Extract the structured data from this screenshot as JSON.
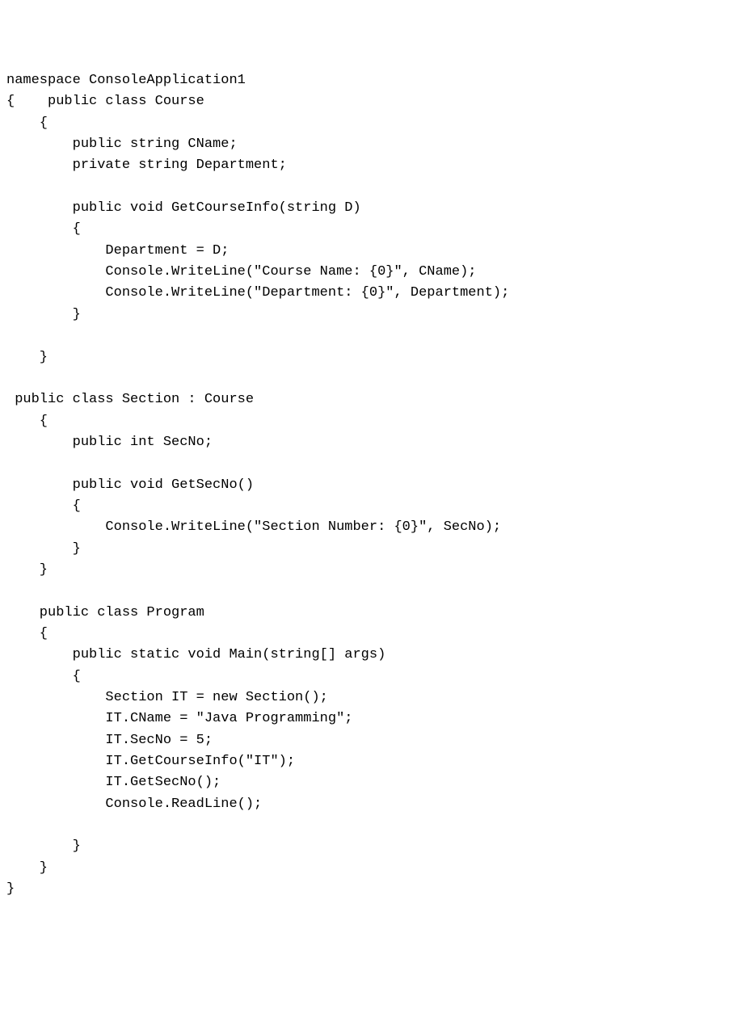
{
  "code": {
    "lines": [
      "namespace ConsoleApplication1",
      "{    public class Course",
      "    {",
      "        public string CName;",
      "        private string Department;",
      "",
      "        public void GetCourseInfo(string D)",
      "        {",
      "            Department = D;",
      "            Console.WriteLine(\"Course Name: {0}\", CName);",
      "            Console.WriteLine(\"Department: {0}\", Department);",
      "        }",
      "",
      "    }",
      "",
      " public class Section : Course",
      "    {",
      "        public int SecNo;",
      "",
      "        public void GetSecNo()",
      "        {",
      "            Console.WriteLine(\"Section Number: {0}\", SecNo);",
      "        }",
      "    }",
      "",
      "    public class Program",
      "    {",
      "        public static void Main(string[] args)",
      "        {",
      "            Section IT = new Section();",
      "            IT.CName = \"Java Programming\";",
      "            IT.SecNo = 5;",
      "            IT.GetCourseInfo(\"IT\");",
      "            IT.GetSecNo();",
      "            Console.ReadLine();",
      "",
      "        }",
      "    }",
      "}"
    ]
  }
}
